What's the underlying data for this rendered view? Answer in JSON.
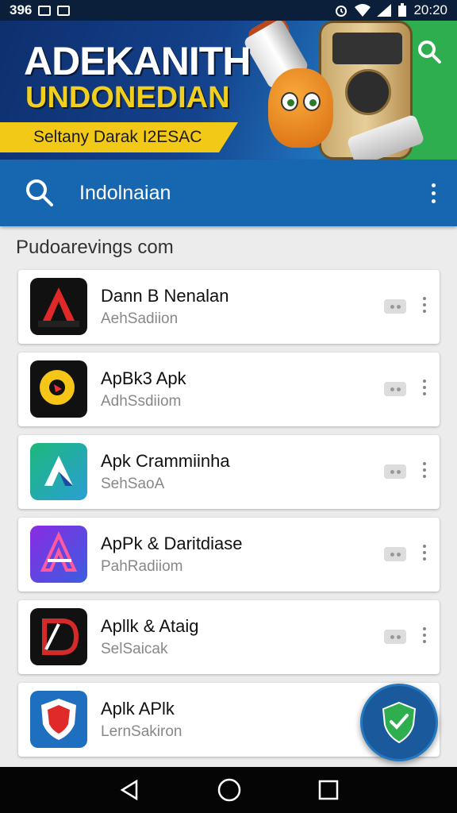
{
  "status_bar": {
    "left_text": "396",
    "time": "20:20"
  },
  "banner": {
    "title": "ADEKANITH",
    "subtitle": "UNDONEDIAN",
    "strip_text": "Seltany Darak I2ESAC"
  },
  "search": {
    "query": "Indolnaian"
  },
  "section": {
    "title": "Pudoarevings com"
  },
  "apps": [
    {
      "name": "Dann B Nenalan",
      "sub": "AehSadiion",
      "icon": "red-a-icon"
    },
    {
      "name": "ApBk3 Apk",
      "sub": "AdhSsdiiom",
      "icon": "yellow-circle-icon"
    },
    {
      "name": "Apk Crammiinha",
      "sub": "SehSaoA",
      "icon": "green-a-icon"
    },
    {
      "name": "ApPk & Daritdiase",
      "sub": "PahRadiiom",
      "icon": "purple-a-icon"
    },
    {
      "name": "Apllk & Ataig",
      "sub": "SelSaicak",
      "icon": "red-d-icon"
    },
    {
      "name": "Aplk APlk",
      "sub": "LernSakiron",
      "icon": "shield-icon"
    }
  ],
  "colors": {
    "primary": "#1667b0",
    "accent": "#f3c918",
    "fab": "#1a5a9c",
    "nav": "#050505"
  }
}
